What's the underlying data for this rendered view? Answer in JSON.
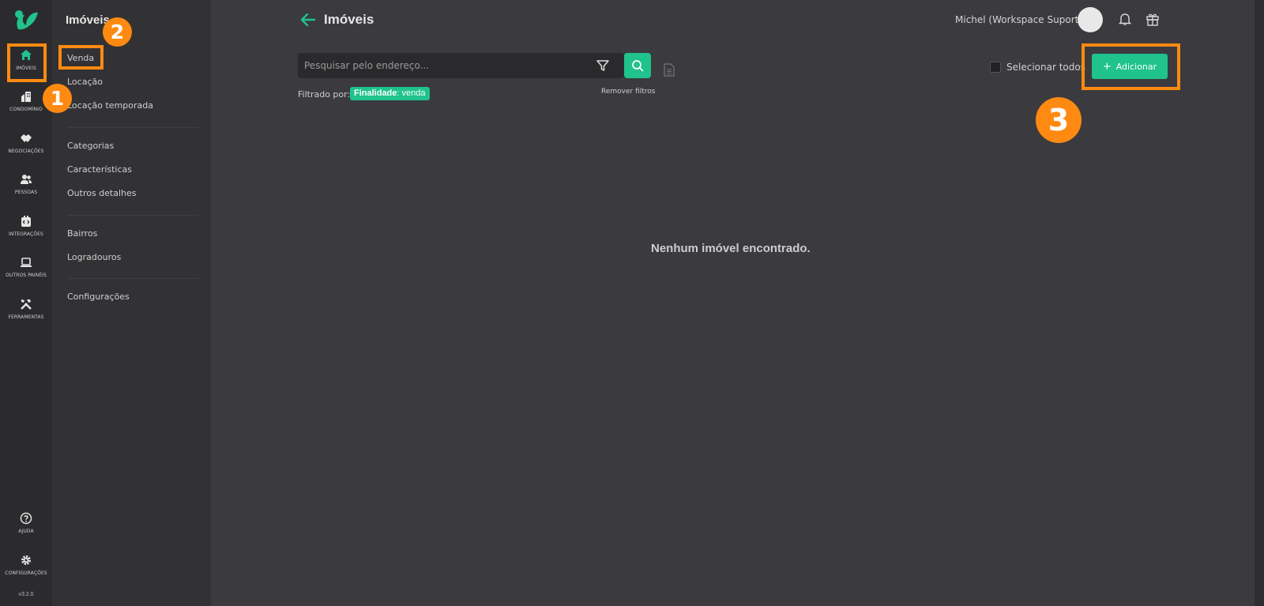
{
  "rail": {
    "items": [
      {
        "label": "IMÓVEIS",
        "icon": "home-icon"
      },
      {
        "label": "CONDOMÍNIO",
        "icon": "building-icon"
      },
      {
        "label": "NEGOCIAÇÕES",
        "icon": "handshake-icon"
      },
      {
        "label": "PESSOAS",
        "icon": "people-icon"
      },
      {
        "label": "INTEGRAÇÕES",
        "icon": "integrations-icon"
      },
      {
        "label": "OUTROS PAINÉIS",
        "icon": "laptop-icon"
      },
      {
        "label": "FERRAMENTAS",
        "icon": "tools-icon"
      }
    ],
    "bottom": [
      {
        "label": "AJUDA",
        "icon": "help-icon"
      },
      {
        "label": "CONFIGURAÇÕES",
        "icon": "gear-icon"
      }
    ],
    "version": "v3.2.0"
  },
  "submenu": {
    "title": "Imóveis",
    "group1": [
      "Venda",
      "Locação",
      "Locação temporada"
    ],
    "group2": [
      "Categorias",
      "Características",
      "Outros detalhes"
    ],
    "group3": [
      "Bairros",
      "Logradouros"
    ],
    "group4": [
      "Configurações"
    ]
  },
  "header": {
    "title": "Imóveis",
    "user": "Michel (Workspace Suporte)"
  },
  "search": {
    "placeholder": "Pesquisar pelo endereço...",
    "filtered_by": "Filtrado por:",
    "chip_key": "Finalidade",
    "chip_value": ": venda",
    "remove_filters": "Remover filtros"
  },
  "actions": {
    "select_all": "Selecionar todos",
    "add": "Adicionar"
  },
  "empty_message": "Nenhum imóvel encontrado.",
  "badges": [
    "1",
    "2",
    "3"
  ],
  "colors": {
    "accent": "#1fc38b",
    "highlight": "#ff8a12",
    "background": "#3b3a3f",
    "sidebar": "#2b2b2e",
    "submenu": "#323235"
  }
}
